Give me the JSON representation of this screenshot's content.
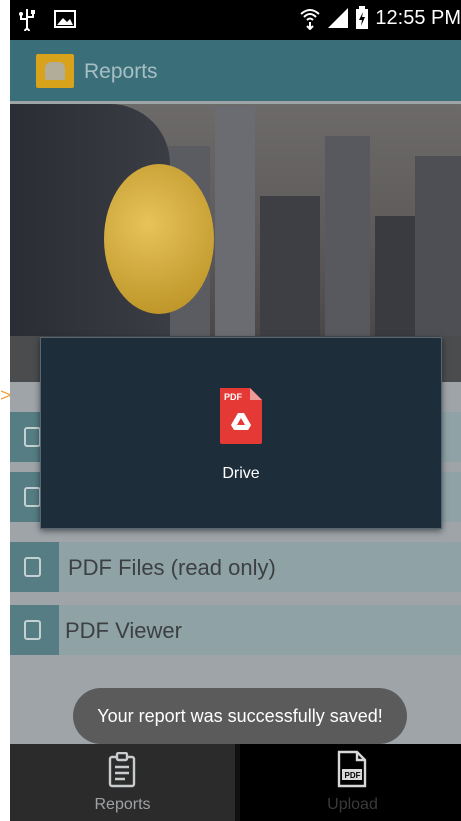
{
  "status_bar": {
    "time": "12:55 PM",
    "left_icons": [
      "usb-icon",
      "image-icon"
    ],
    "right_icons": [
      "wifi-icon",
      "signal-icon",
      "battery-charging-icon"
    ]
  },
  "app_bar": {
    "title": "Reports",
    "logo_icon": "reports-logo-icon"
  },
  "list": {
    "items": [
      {
        "label": "",
        "icon": "document-icon"
      },
      {
        "label": "",
        "icon": "document-icon"
      },
      {
        "label": "PDF Files (read only)",
        "icon": "document-icon"
      },
      {
        "label": "PDF Viewer",
        "icon": "document-icon"
      }
    ]
  },
  "dialog": {
    "option_label": "Drive",
    "option_icon": "drive-pdf-icon",
    "option_icon_text": "PDF"
  },
  "toast": {
    "message": "Your report was successfully saved!"
  },
  "bottom_nav": {
    "tabs": [
      {
        "label": "Reports",
        "icon": "clipboard-icon"
      },
      {
        "label": "Upload",
        "icon": "pdf-file-icon",
        "icon_text": "PDF"
      }
    ]
  },
  "colors": {
    "app_bar": "#3a6f79",
    "list_row": "#8fa3a7",
    "list_icon_box": "#557d83",
    "dialog": "#1d2d3a",
    "drive_red": "#e53935",
    "toast": "#5b5b5c"
  }
}
